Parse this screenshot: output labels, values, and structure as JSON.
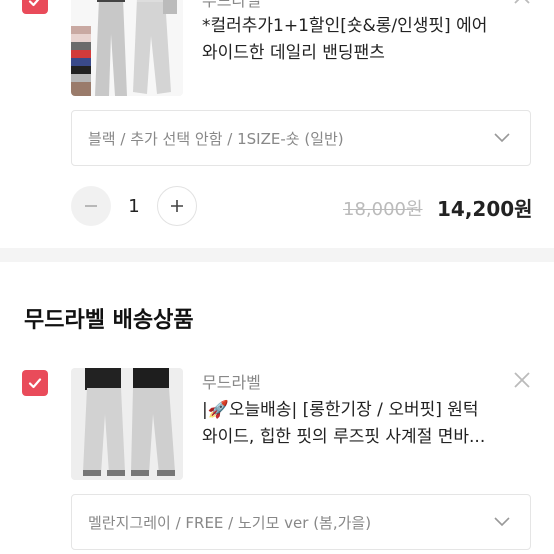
{
  "items": [
    {
      "brand": "무드라벨",
      "name_line1": "*컬러추가1+1할인[숏&롱/인생핏] 에어",
      "name_line2": "와이드한 데일리 밴딩팬츠",
      "option": "블랙 / 추가 선택 안함 / 1SIZE-숏 (일반)",
      "quantity": "1",
      "original_price": "18,000원",
      "sale_price": "14,200원"
    },
    {
      "brand": "무드라벨",
      "name_line1": "|🚀오늘배송| [롱한기장 / 오버핏] 원턱",
      "name_line2": "와이드, 힙한 핏의 루즈핏 사계절 면바...",
      "option": "멜란지그레이 / FREE / 노기모 ver (봄,가을)"
    }
  ],
  "section": {
    "title": "무드라벨 배송상품"
  },
  "colors": {
    "accent": "#e94b5a",
    "divider": "#f4f4f4"
  },
  "icons": [
    "check-icon",
    "close-icon",
    "chevron-down-icon",
    "minus-icon",
    "plus-icon"
  ]
}
